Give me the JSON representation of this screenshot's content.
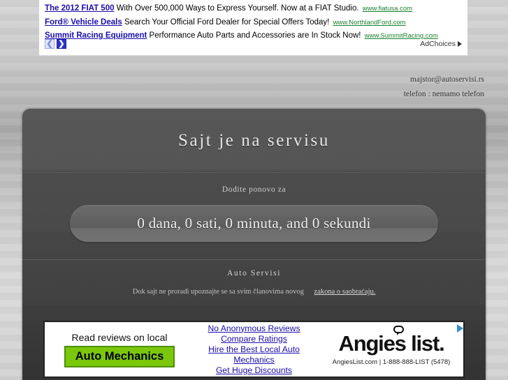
{
  "top_ad": {
    "ads": [
      {
        "title": "The 2012 FIAT 500",
        "desc": "With Over 500,000 Ways to Express Yourself. Now at a FIAT Studio.",
        "url": "www.fiatusa.com"
      },
      {
        "title": "Ford® Vehicle Deals",
        "desc": "Search Your Official Ford Dealer for Special Offers Today!",
        "url": "www.NorthlandFord.com"
      },
      {
        "title": "Summit Racing Equipment",
        "desc": "Performance Auto Parts and Accessories are In Stock Now!",
        "url": "www.SummitRacing.com"
      }
    ],
    "prev_arrow": "❮",
    "next_arrow": "❯",
    "adchoices_label": "AdChoices"
  },
  "contact": {
    "email": "majstor@autoservisi.rs",
    "phone": "telefon : nemamo telefon"
  },
  "panel": {
    "title": "Sajt je na servisu",
    "countdown_label": "Dodite ponovo za",
    "countdown_value": "0 dana, 0 sati, 0 minuta, and 0 sekundi",
    "footer_title": "Auto Servisi",
    "footer_note": "Dok sajt ne proradi upoznajte se sa svim članovima novog",
    "footer_link": "zakona o saobraćaju."
  },
  "bottom_ad": {
    "headline": "Read reviews on local",
    "badge": "Auto Mechanics",
    "links": [
      "No Anonymous Reviews",
      "Compare Ratings",
      "Hire the Best Local Auto Mechanics",
      "Get Huge Discounts"
    ],
    "logo": "Angies list.",
    "tagline": "AngiesList.com | 1-888-888-LIST (5478)"
  },
  "colors": {
    "link_blue": "#1a0dab",
    "url_green": "#1a7f2e",
    "badge_green": "#7ac70c",
    "panel_dark": "#4a4a4a",
    "page_bg": "#cfcfcf"
  }
}
